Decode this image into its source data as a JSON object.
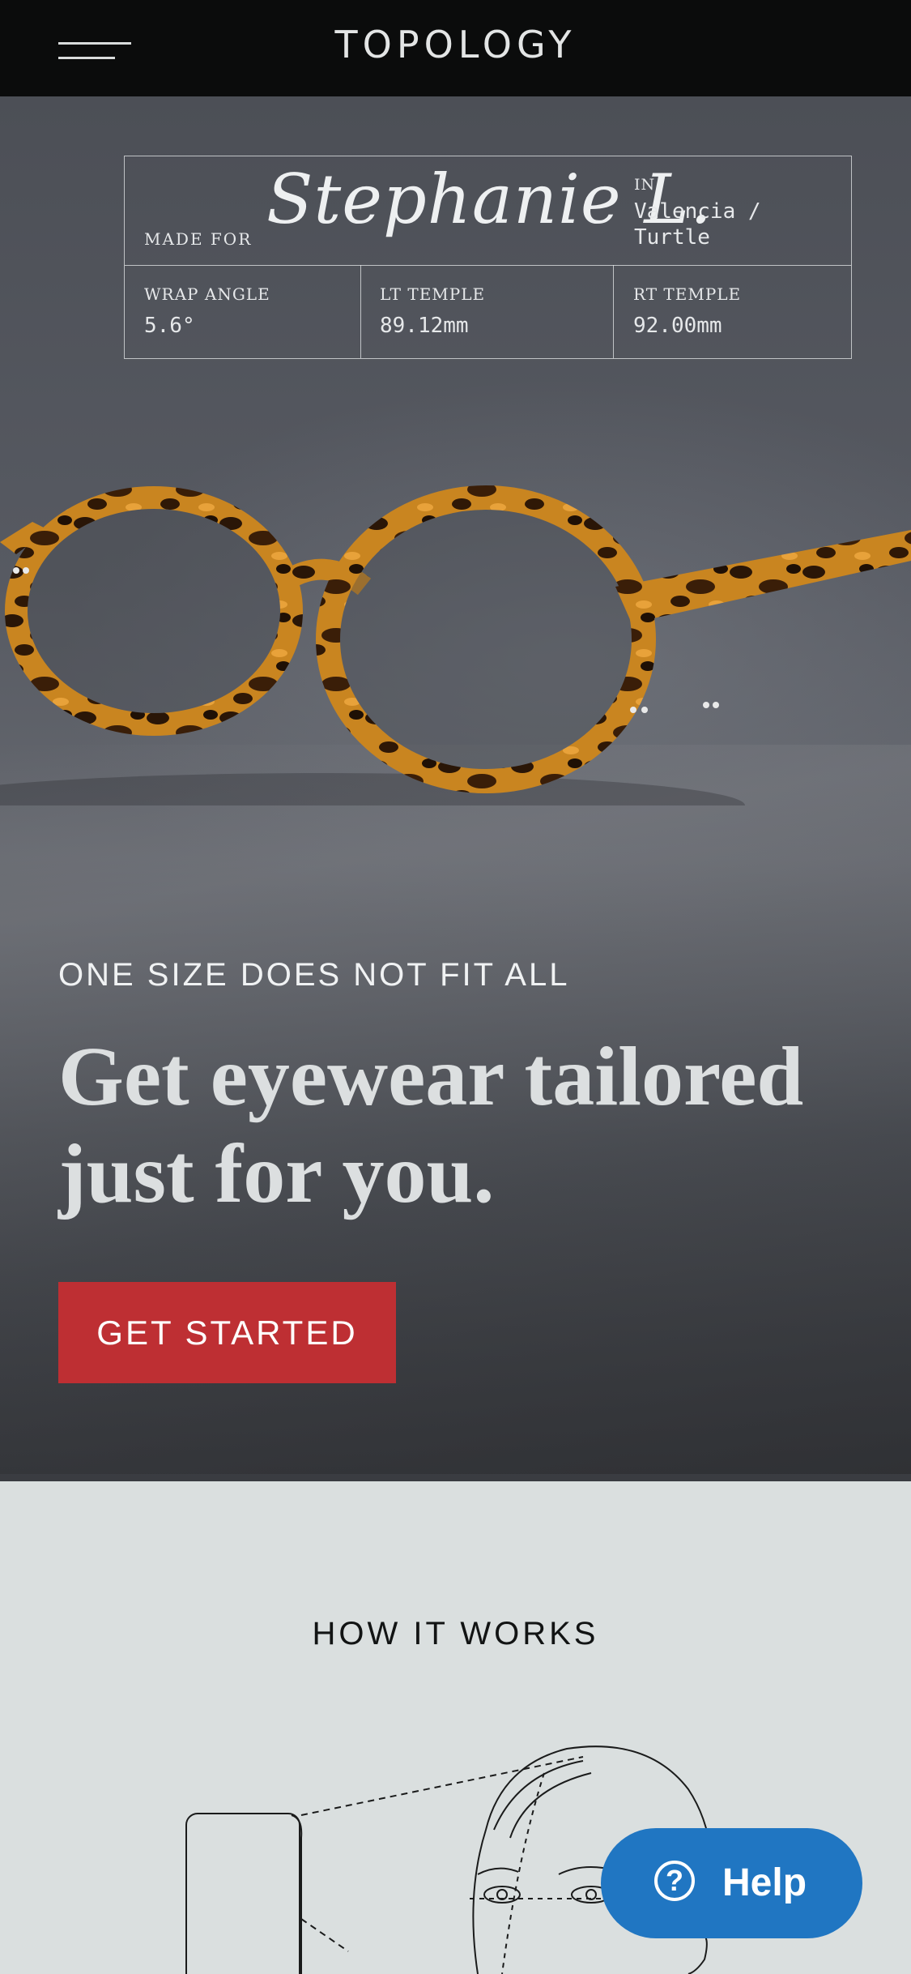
{
  "header": {
    "logo": "TOPOLOGY",
    "menu_icon": "hamburger-menu-icon"
  },
  "hero": {
    "spec_card": {
      "made_for_label": "MADE FOR",
      "customer_name": "Stephanie L.",
      "in_label": "IN",
      "frame_name": "Valencia / Turtle",
      "specs": [
        {
          "label": "WRAP ANGLE",
          "value": "5.6°"
        },
        {
          "label": "LT TEMPLE",
          "value": "89.12mm"
        },
        {
          "label": "RT TEMPLE",
          "value": "92.00mm"
        }
      ]
    },
    "eyebrow": "ONE SIZE DOES NOT FIT ALL",
    "headline": "Get eyewear tailored just for you.",
    "cta_label": "GET STARTED",
    "colors": {
      "cta": "#be2f33",
      "hero_bg": "#4c4f56",
      "tortoise": "#c7801f"
    }
  },
  "how_it_works": {
    "title": "HOW IT WORKS"
  },
  "help": {
    "label": "Help",
    "icon": "question-circle-icon",
    "color": "#2076c2"
  }
}
